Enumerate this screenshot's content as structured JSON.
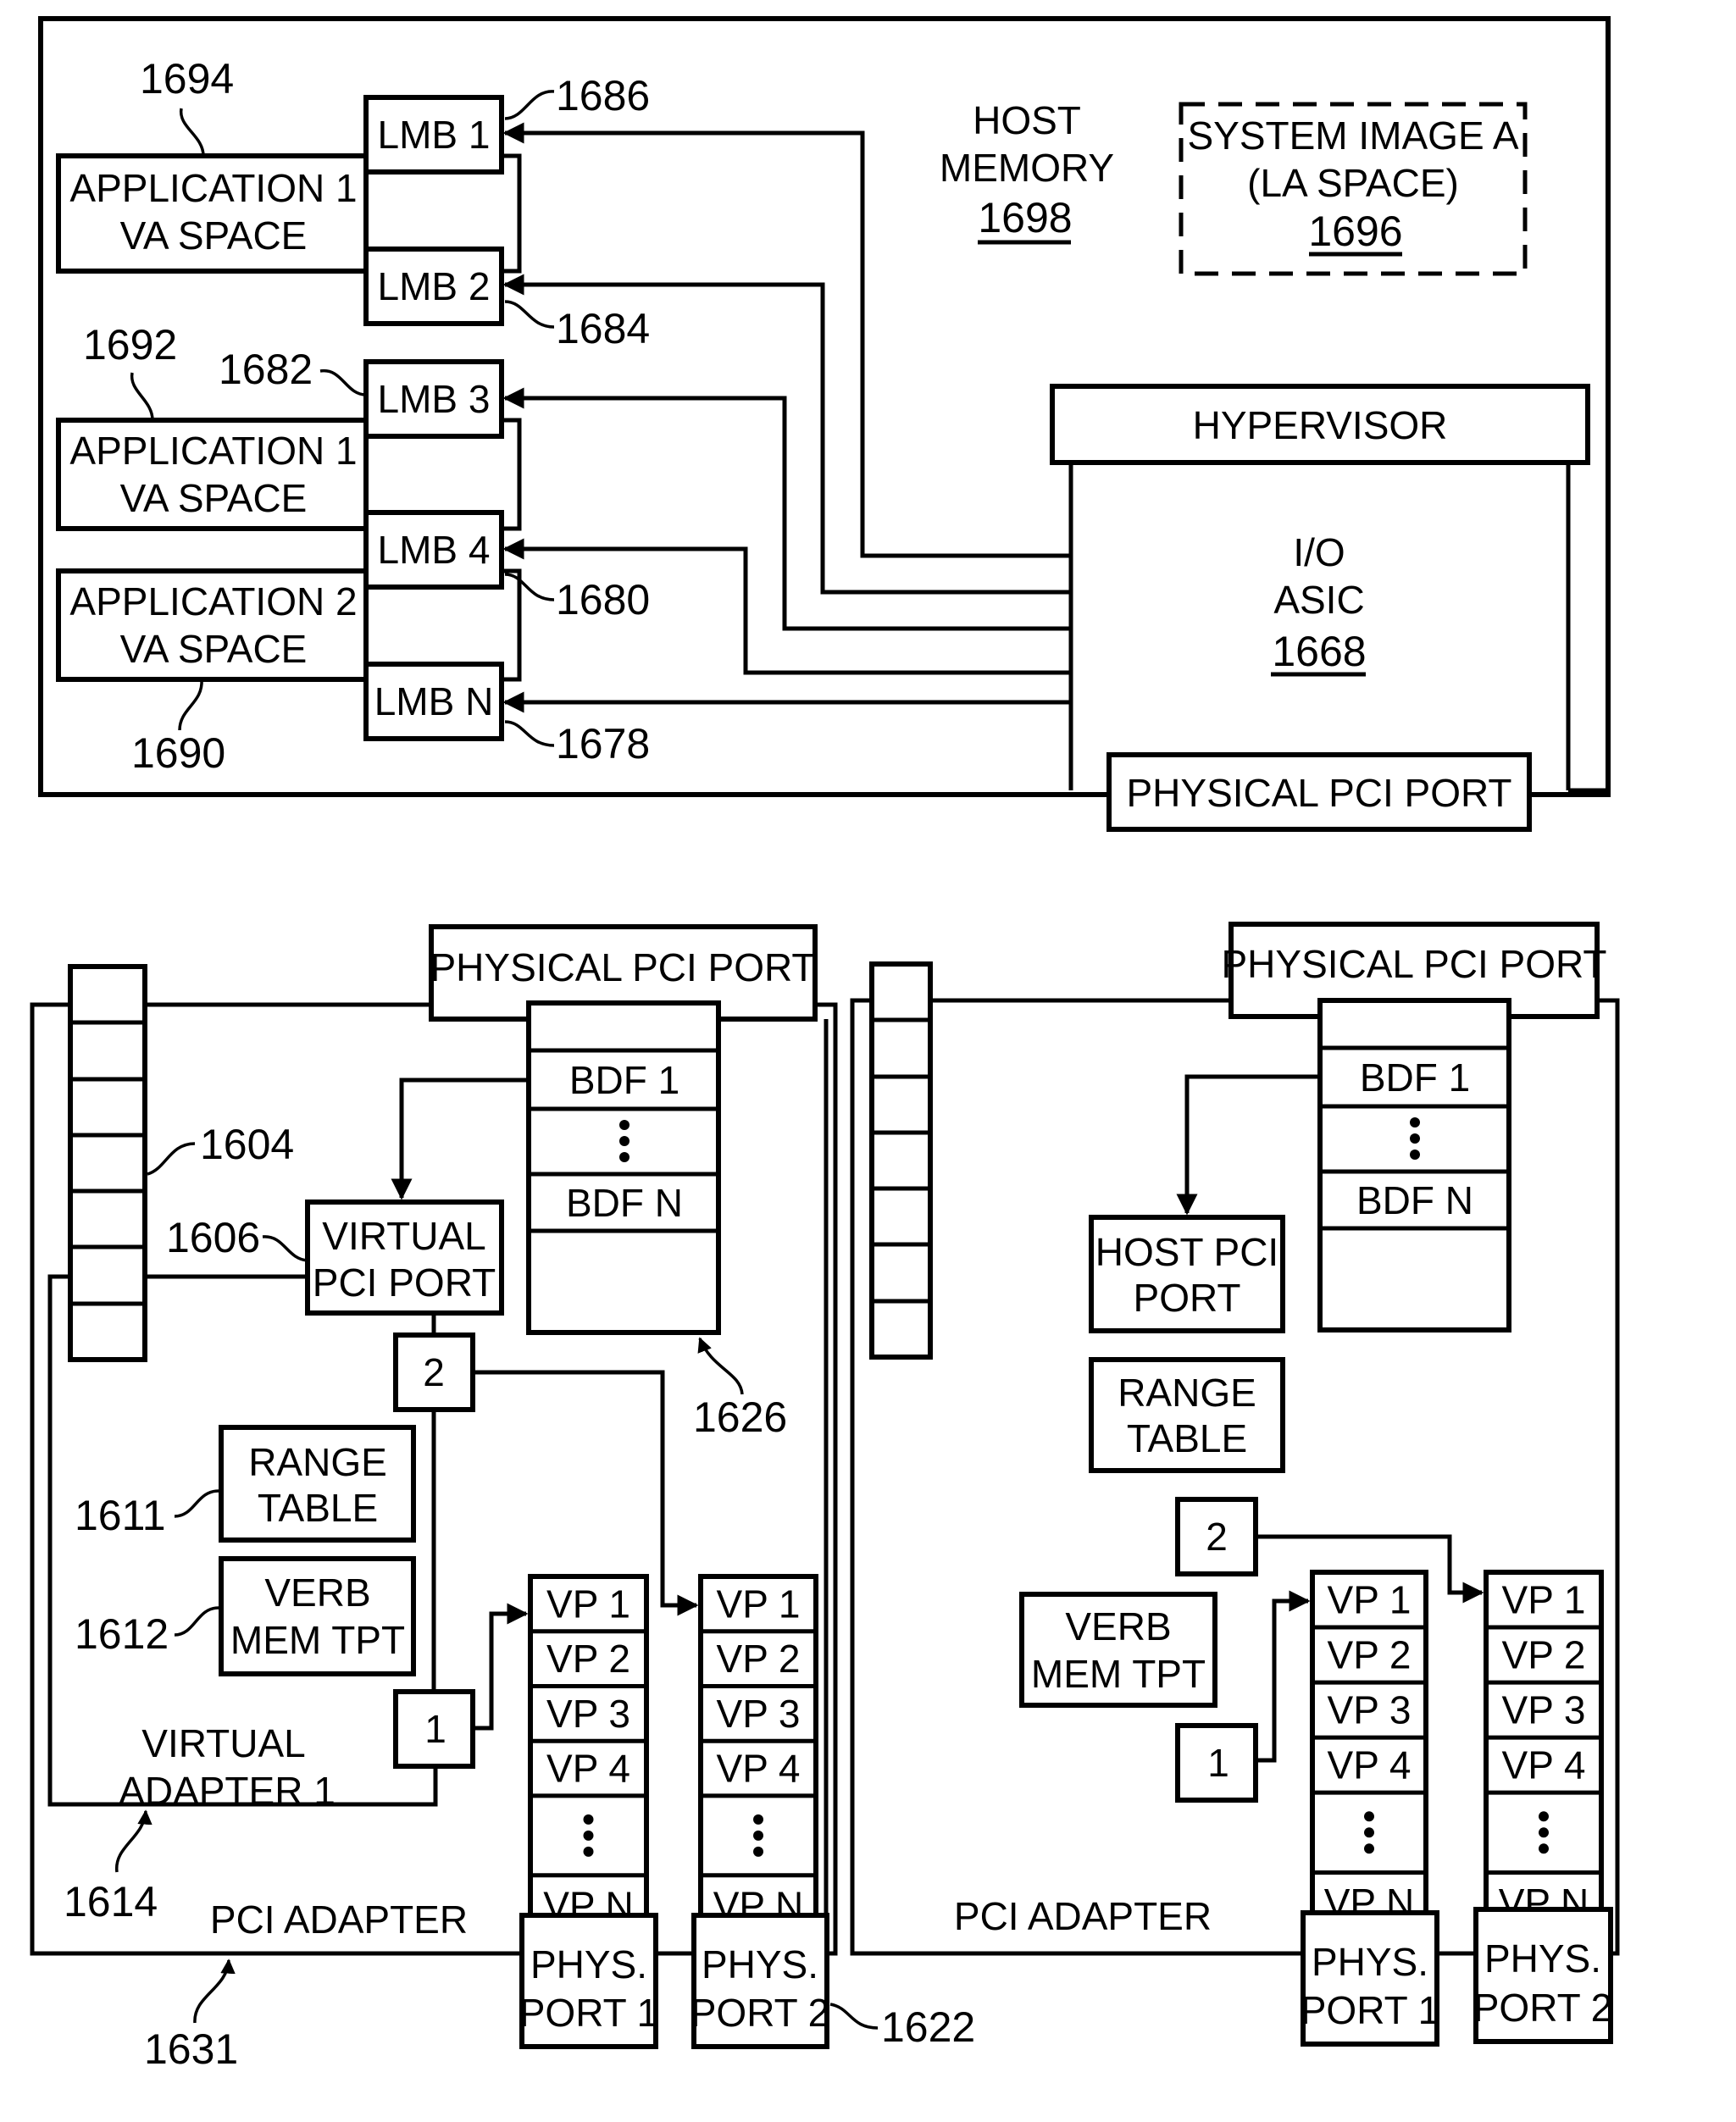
{
  "host": {
    "memory_label_1": "HOST",
    "memory_label_2": "MEMORY",
    "memory_ref": "1698",
    "system_image_1": "SYSTEM IMAGE A",
    "system_image_2": "(LA SPACE)",
    "system_image_ref": "1696",
    "hypervisor": "HYPERVISOR",
    "asic_1": "I/O",
    "asic_2": "ASIC",
    "asic_ref": "1668",
    "physical_pci_port": "PHYSICAL PCI PORT",
    "apps": [
      {
        "line1": "APPLICATION 1",
        "line2": "VA SPACE",
        "ref": "1694"
      },
      {
        "line1": "APPLICATION 1",
        "line2": "VA SPACE",
        "ref": "1692"
      },
      {
        "line1": "APPLICATION 2",
        "line2": "VA SPACE",
        "ref": "1690"
      }
    ],
    "lmbs": [
      {
        "label": "LMB 1",
        "ref": "1686"
      },
      {
        "label": "LMB 2",
        "ref": "1684"
      },
      {
        "label": "LMB 3",
        "ref": "1682"
      },
      {
        "label": "LMB 4",
        "ref": "1680"
      },
      {
        "label": "LMB N",
        "ref": "1678"
      }
    ]
  },
  "adapter_left": {
    "label": "PCI ADAPTER",
    "ref": "1631",
    "physical_pci_port": "PHYSICAL PCI PORT",
    "bdf_1": "BDF 1",
    "bdf_n": "BDF N",
    "bdf_table_ref": "1626",
    "stack_ref": "1604",
    "virtual_pci_port_1": "VIRTUAL",
    "virtual_pci_port_2": "PCI PORT",
    "virtual_pci_port_ref": "1606",
    "range_table_1": "RANGE",
    "range_table_2": "TABLE",
    "range_table_ref": "1611",
    "verb_1": "VERB",
    "verb_2": "MEM TPT",
    "verb_ref": "1612",
    "virtual_adapter_1": "VIRTUAL",
    "virtual_adapter_2": "ADAPTER 1",
    "virtual_adapter_ref": "1614",
    "box_2": "2",
    "box_1": "1",
    "vp_labels": [
      "VP 1",
      "VP 2",
      "VP 3",
      "VP 4",
      "",
      "VP N"
    ],
    "phys_port_1": [
      "PHYS.",
      "PORT 1"
    ],
    "phys_port_2": [
      "PHYS.",
      "PORT 2"
    ],
    "phys_port_ref": "1622"
  },
  "adapter_right": {
    "label": "PCI ADAPTER",
    "physical_pci_port": "PHYSICAL PCI PORT",
    "bdf_1": "BDF 1",
    "bdf_n": "BDF N",
    "host_pci_port_1": "HOST PCI",
    "host_pci_port_2": "PORT",
    "range_table_1": "RANGE",
    "range_table_2": "TABLE",
    "verb_1": "VERB",
    "verb_2": "MEM TPT",
    "box_2": "2",
    "box_1": "1",
    "vp_labels": [
      "VP 1",
      "VP 2",
      "VP 3",
      "VP 4",
      "",
      "VP N"
    ],
    "phys_port_1": [
      "PHYS.",
      "PORT 1"
    ],
    "phys_port_2": [
      "PHYS.",
      "PORT 2"
    ]
  }
}
